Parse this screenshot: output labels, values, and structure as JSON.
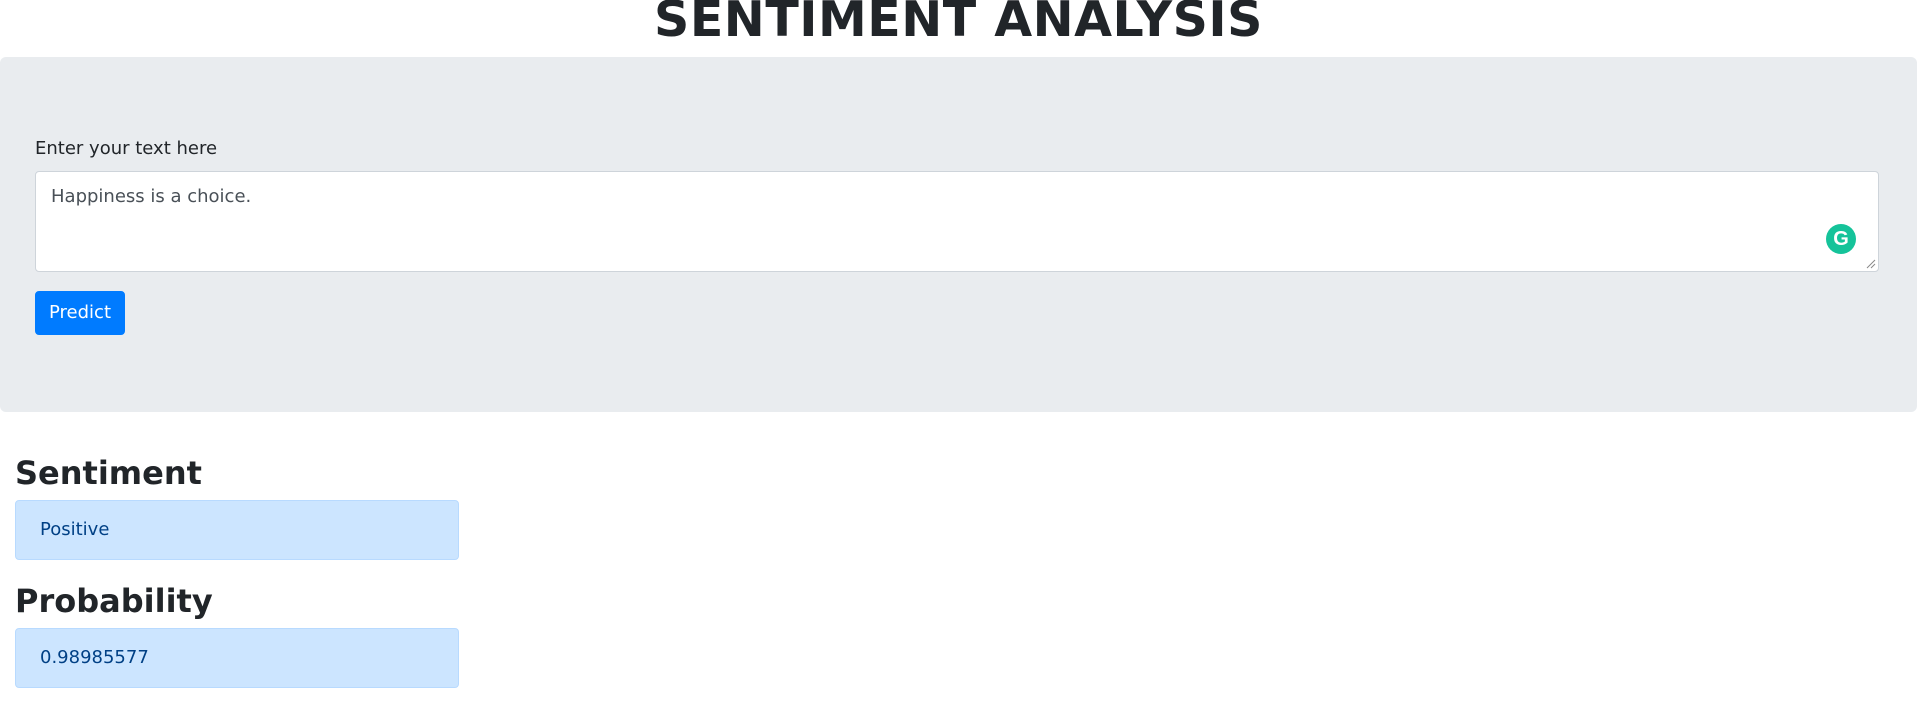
{
  "header": {
    "title": "SENTIMENT ANALYSIS"
  },
  "form": {
    "input_label": "Enter your text here",
    "input_value": "Happiness is a choice.",
    "grammarly_icon": "grammarly-g-icon",
    "grammarly_letter": "G",
    "predict_label": "Predict"
  },
  "results": {
    "sentiment_heading": "Sentiment",
    "sentiment_value": "Positive",
    "probability_heading": "Probability",
    "probability_value": "0.98985577"
  },
  "colors": {
    "jumbotron_bg": "#e9ecef",
    "primary_button": "#007bff",
    "alert_bg": "#cce5ff",
    "alert_text": "#004085",
    "grammarly": "#15c39a"
  }
}
